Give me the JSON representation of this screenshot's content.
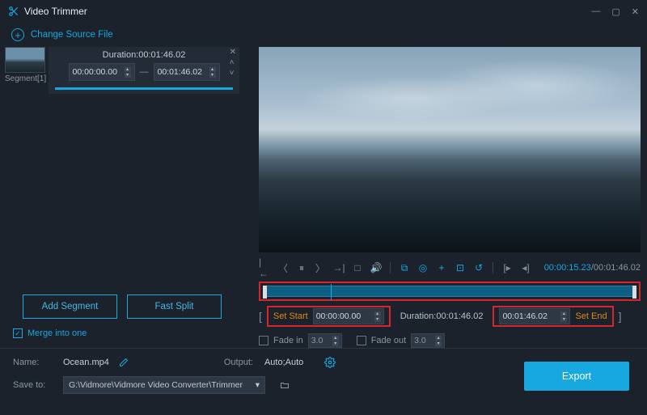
{
  "app": {
    "title": "Video Trimmer"
  },
  "source": {
    "change_label": "Change Source File"
  },
  "segment": {
    "label": "Segment[1]",
    "duration_label": "Duration:00:01:46.02",
    "start": "00:00:00.00",
    "end": "00:01:46.02"
  },
  "buttons": {
    "add_segment": "Add Segment",
    "fast_split": "Fast Split",
    "export": "Export"
  },
  "merge": {
    "label": "Merge into one",
    "checked": true
  },
  "playback": {
    "current": "00:00:15.23",
    "total": "00:01:46.02"
  },
  "trim": {
    "set_start_label": "Set Start",
    "start": "00:00:00.00",
    "duration_label": "Duration:00:01:46.02",
    "end": "00:01:46.02",
    "set_end_label": "Set End"
  },
  "fade": {
    "in_label": "Fade in",
    "in_value": "3.0",
    "out_label": "Fade out",
    "out_value": "3.0"
  },
  "output": {
    "name_label": "Name:",
    "name_value": "Ocean.mp4",
    "output_label": "Output:",
    "output_value": "Auto;Auto",
    "save_label": "Save to:",
    "save_path": "G:\\Vidmore\\Vidmore Video Converter\\Trimmer"
  }
}
